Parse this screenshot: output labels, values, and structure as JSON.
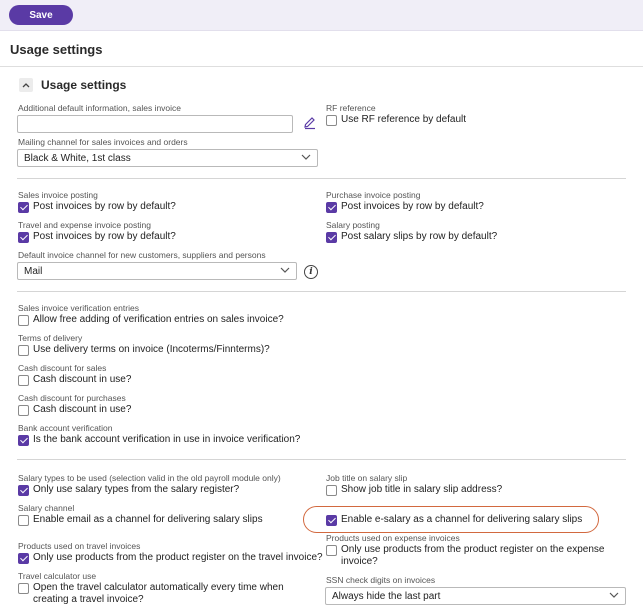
{
  "toolbar": {
    "save_label": "Save"
  },
  "page": {
    "title": "Usage settings"
  },
  "section": {
    "title": "Usage settings",
    "collapse_icon": "chevron-up-icon"
  },
  "invoice_info": {
    "additional_info_label": "Additional default information, sales invoice",
    "additional_info_value": "",
    "edit_icon": "pencil-icon",
    "rf_reference_label": "RF reference",
    "rf_reference_checkbox": "Use RF reference by default",
    "rf_reference_checked": false,
    "mailing_channel_label": "Mailing channel for sales invoices and orders",
    "mailing_channel_value": "Black & White, 1st class"
  },
  "posting": {
    "sales_label": "Sales invoice posting",
    "sales_checkbox": "Post invoices by row by default?",
    "sales_checked": true,
    "purchase_label": "Purchase invoice posting",
    "purchase_checkbox": "Post invoices by row by default?",
    "purchase_checked": true,
    "travel_label": "Travel and expense invoice posting",
    "travel_checkbox": "Post invoices by row by default?",
    "travel_checked": true,
    "salary_label": "Salary posting",
    "salary_checkbox": "Post salary slips by row by default?",
    "salary_checked": true,
    "default_channel_label": "Default invoice channel for new customers, suppliers and persons",
    "default_channel_value": "Mail",
    "info_icon": "info-icon"
  },
  "verification": {
    "sales_ver_label": "Sales invoice verification entries",
    "sales_ver_checkbox": "Allow free adding of verification entries on sales invoice?",
    "sales_ver_checked": false,
    "terms_label": "Terms of delivery",
    "terms_checkbox": "Use delivery terms on invoice (Incoterms/Finnterms)?",
    "terms_checked": false,
    "cash_sales_label": "Cash discount for sales",
    "cash_sales_checkbox": "Cash discount in use?",
    "cash_sales_checked": false,
    "cash_purchases_label": "Cash discount for purchases",
    "cash_purchases_checkbox": "Cash discount in use?",
    "cash_purchases_checked": false,
    "bank_label": "Bank account verification",
    "bank_checkbox": "Is the bank account verification in use in invoice verification?",
    "bank_checked": true
  },
  "salary": {
    "types_label": "Salary types to be used (selection valid in the old payroll module only)",
    "types_checkbox": "Only use salary types from the salary register?",
    "types_checked": true,
    "job_title_label": "Job title on salary slip",
    "job_title_checkbox": "Show job title in salary slip address?",
    "job_title_checked": false,
    "channel_label": "Salary channel",
    "email_checkbox": "Enable email as a channel for delivering salary slips",
    "email_checked": false,
    "esalary_checkbox": "Enable e-salary as a channel for delivering salary slips",
    "esalary_checked": true,
    "travel_products_label": "Products used on travel invoices",
    "travel_products_checkbox": "Only use products from the product register on the travel invoice?",
    "travel_products_checked": true,
    "expense_products_label": "Products used on expense invoices",
    "expense_products_checkbox": "Only use products from the product register on the expense invoice?",
    "expense_products_checked": false,
    "travel_calc_label": "Travel calculator use",
    "travel_calc_checkbox": "Open the travel calculator automatically every time when creating a travel invoice?",
    "travel_calc_checked": false,
    "ssn_label": "SSN check digits on invoices",
    "ssn_value": "Always hide the last part"
  },
  "colors": {
    "accent": "#5a3aa5",
    "highlight": "#d2693f"
  }
}
